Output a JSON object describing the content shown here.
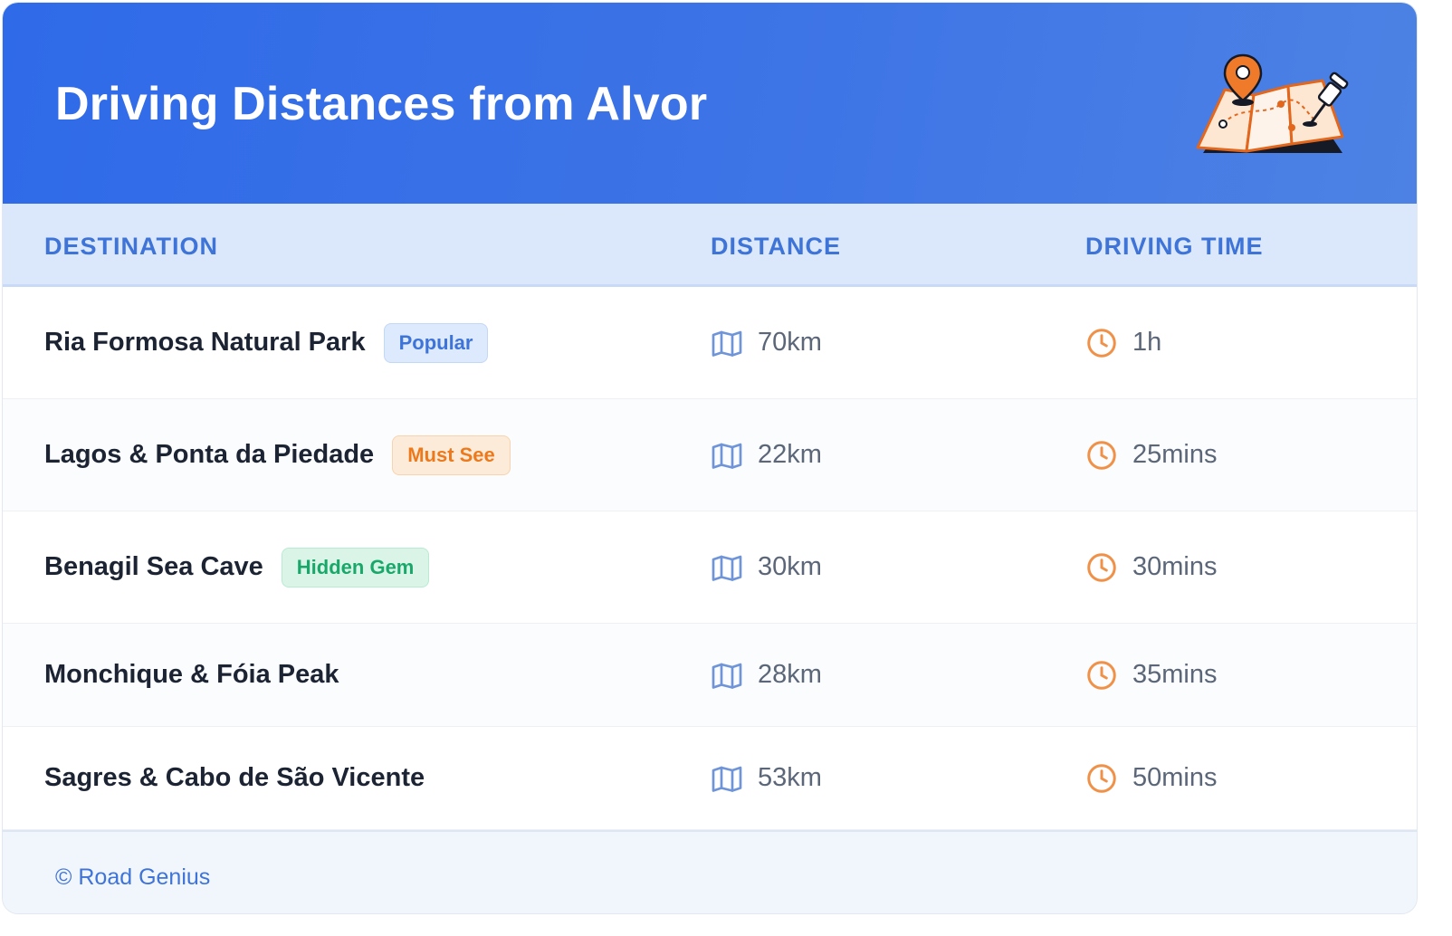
{
  "header": {
    "title": "Driving Distances from Alvor",
    "illustration_icon": "folded-map-with-pins-icon"
  },
  "table": {
    "columns": [
      "DESTINATION",
      "DISTANCE",
      "DRIVING TIME"
    ],
    "distance_icon": "map-icon",
    "time_icon": "clock-icon",
    "rows": [
      {
        "destination": "Ria Formosa Natural Park",
        "badge": "Popular",
        "badge_color": "blue",
        "distance": "70km",
        "time": "1h"
      },
      {
        "destination": "Lagos & Ponta da Piedade",
        "badge": "Must See",
        "badge_color": "orange",
        "distance": "22km",
        "time": "25mins"
      },
      {
        "destination": "Benagil Sea Cave",
        "badge": "Hidden Gem",
        "badge_color": "green",
        "distance": "30km",
        "time": "30mins"
      },
      {
        "destination": "Monchique & Fóia Peak",
        "badge": "",
        "badge_color": "",
        "distance": "28km",
        "time": "35mins"
      },
      {
        "destination": "Sagres & Cabo de São Vicente",
        "badge": "",
        "badge_color": "",
        "distance": "53km",
        "time": "50mins"
      }
    ]
  },
  "footer": {
    "credit": "© Road Genius"
  },
  "colors": {
    "header_gradient_start": "#2f6ae8",
    "header_gradient_end": "#4d82e4",
    "accent_blue": "#3e74d8",
    "accent_orange": "#ec7a1c",
    "accent_green": "#1aa86a"
  }
}
